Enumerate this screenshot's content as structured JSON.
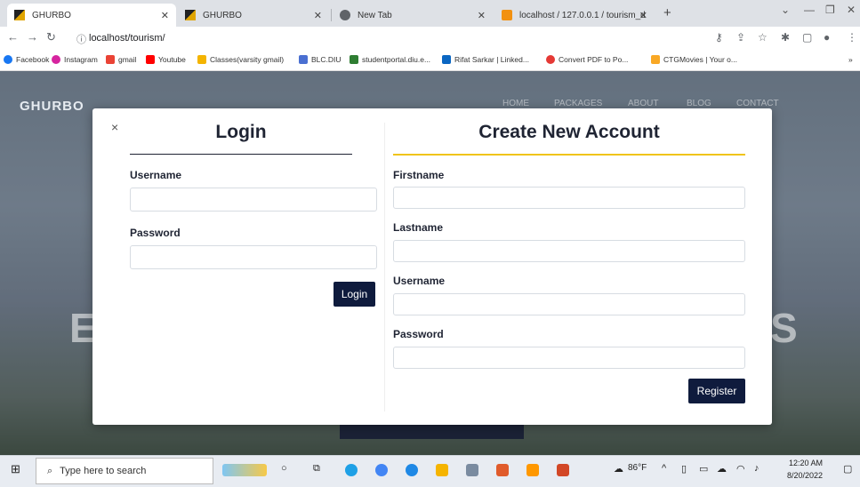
{
  "browser": {
    "tabs": [
      {
        "title": "GHURBO",
        "active": true
      },
      {
        "title": "GHURBO",
        "active": false
      },
      {
        "title": "New Tab",
        "active": false
      },
      {
        "title": "localhost / 127.0.0.1 / tourism_d",
        "active": false
      }
    ],
    "url": "localhost/tourism/",
    "bookmarks": [
      "Facebook",
      "Instagram",
      "gmail",
      "Youtube",
      "Classes(varsity gmail)",
      "BLC.DIU",
      "studentportal.diu.e...",
      "Rifat Sarkar | Linked...",
      "Convert PDF to Po...",
      "CTGMovies | Your o..."
    ]
  },
  "site": {
    "logo": "GHURBO",
    "nav": [
      "HOME",
      "PACKAGES",
      "ABOUT",
      "BLOG",
      "CONTACT"
    ],
    "hero_left_letter": "E",
    "hero_right_letter": "S"
  },
  "modal": {
    "close": "×",
    "login": {
      "title": "Login",
      "username_label": "Username",
      "username_value": "",
      "password_label": "Password",
      "password_value": "",
      "button": "Login"
    },
    "register": {
      "title": "Create New Account",
      "firstname_label": "Firstname",
      "lastname_label": "Lastname",
      "username_label": "Username",
      "password_label": "Password",
      "button": "Register"
    }
  },
  "taskbar": {
    "search_placeholder": "Type here to search",
    "weather": "86°F",
    "time": "12:20 AM",
    "date": "8/20/2022"
  },
  "colors": {
    "accent_dark": "#0f1b3d",
    "register_underline": "#f0c419",
    "login_underline": "#1f2433"
  }
}
